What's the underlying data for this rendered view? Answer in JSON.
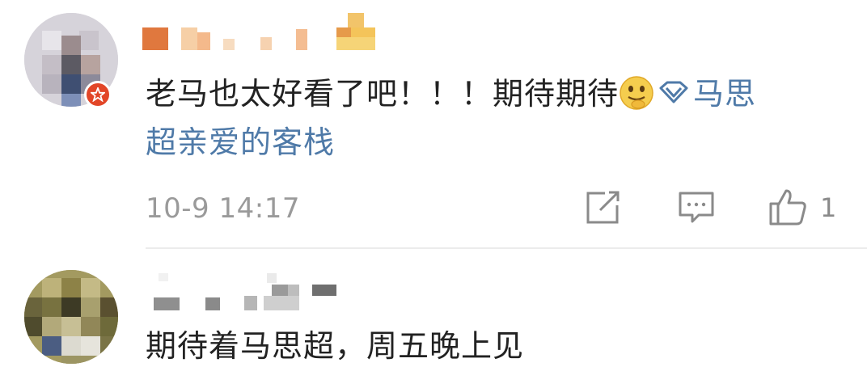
{
  "comments": [
    {
      "text": "老马也太好看了吧！！！期待期待",
      "emoji": "thinking-emoji",
      "topic_icon": "diamond-icon",
      "topic_line1": "马思",
      "topic_line2": "超亲爱的客栈",
      "time": "10-9 14:17",
      "likes": "1"
    },
    {
      "text": "期待着马思超，周五晚上见"
    }
  ],
  "colors": {
    "topic": "#4f7aa8",
    "vip_badge": "#e24628",
    "meta_gray": "#9a9a9a"
  }
}
